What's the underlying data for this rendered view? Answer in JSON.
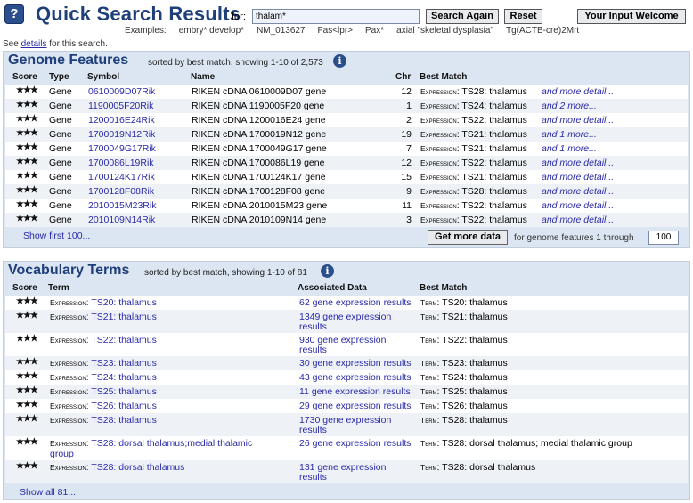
{
  "header": {
    "help_glyph": "?",
    "title": "Quick Search Results",
    "for_label": "for:",
    "query": "thalam*",
    "search_again": "Search Again",
    "reset": "Reset",
    "welcome": "Your Input Welcome",
    "examples_label": "Examples:",
    "examples": [
      "embry* develop*",
      "NM_013627",
      "Fas<lpr>",
      "Pax*",
      "axial \"skeletal dysplasia\"",
      "Tg(ACTB-cre)2Mrt"
    ],
    "see_pre": "See",
    "see_link": "details",
    "see_post": "for this search."
  },
  "genome": {
    "title": "Genome Features",
    "subtitle": "sorted by best match, showing 1-10 of 2,573",
    "columns": {
      "score": "Score",
      "type": "Type",
      "symbol": "Symbol",
      "name": "Name",
      "chr": "Chr",
      "best": "Best Match"
    },
    "rows": [
      {
        "stars": "★★★",
        "type": "Gene",
        "symbol": "0610009D07Rik",
        "name": "RIKEN cDNA 0610009D07 gene",
        "chr": "12",
        "exp": "Expression",
        "match": ": TS28: thalamus",
        "more": "and more detail..."
      },
      {
        "stars": "★★★",
        "type": "Gene",
        "symbol": "1190005F20Rik",
        "name": "RIKEN cDNA 1190005F20 gene",
        "chr": "1",
        "exp": "Expression",
        "match": ": TS24: thalamus",
        "more": "and 2 more..."
      },
      {
        "stars": "★★★",
        "type": "Gene",
        "symbol": "1200016E24Rik",
        "name": "RIKEN cDNA 1200016E24 gene",
        "chr": "2",
        "exp": "Expression",
        "match": ": TS22: thalamus",
        "more": "and more detail..."
      },
      {
        "stars": "★★★",
        "type": "Gene",
        "symbol": "1700019N12Rik",
        "name": "RIKEN cDNA 1700019N12 gene",
        "chr": "19",
        "exp": "Expression",
        "match": ": TS21: thalamus",
        "more": "and 1 more..."
      },
      {
        "stars": "★★★",
        "type": "Gene",
        "symbol": "1700049G17Rik",
        "name": "RIKEN cDNA 1700049G17 gene",
        "chr": "7",
        "exp": "Expression",
        "match": ": TS21: thalamus",
        "more": "and 1 more..."
      },
      {
        "stars": "★★★",
        "type": "Gene",
        "symbol": "1700086L19Rik",
        "name": "RIKEN cDNA 1700086L19 gene",
        "chr": "12",
        "exp": "Expression",
        "match": ": TS22: thalamus",
        "more": "and more detail..."
      },
      {
        "stars": "★★★",
        "type": "Gene",
        "symbol": "1700124K17Rik",
        "name": "RIKEN cDNA 1700124K17 gene",
        "chr": "15",
        "exp": "Expression",
        "match": ": TS21: thalamus",
        "more": "and more detail..."
      },
      {
        "stars": "★★★",
        "type": "Gene",
        "symbol": "1700128F08Rik",
        "name": "RIKEN cDNA 1700128F08 gene",
        "chr": "9",
        "exp": "Expression",
        "match": ": TS28: thalamus",
        "more": "and more detail..."
      },
      {
        "stars": "★★★",
        "type": "Gene",
        "symbol": "2010015M23Rik",
        "name": "RIKEN cDNA 2010015M23 gene",
        "chr": "11",
        "exp": "Expression",
        "match": ": TS22: thalamus",
        "more": "and more detail..."
      },
      {
        "stars": "★★★",
        "type": "Gene",
        "symbol": "2010109N14Rik",
        "name": "RIKEN cDNA 2010109N14 gene",
        "chr": "3",
        "exp": "Expression",
        "match": ": TS22: thalamus",
        "more": "and more detail..."
      }
    ],
    "show_first": "Show first 100...",
    "get_more": "Get more data",
    "get_more_suffix": "for genome features 1 through",
    "through_value": "100"
  },
  "vocab": {
    "title": "Vocabulary Terms",
    "subtitle": "sorted by best match, showing 1-10 of 81",
    "columns": {
      "score": "Score",
      "term": "Term",
      "assoc": "Associated Data",
      "best": "Best Match"
    },
    "rows": [
      {
        "stars": "★★★",
        "exp": "Expression",
        "term": ": TS20: thalamus",
        "term2": "",
        "assoc": "62 gene expression results",
        "assoc2": "",
        "bm_label": "Term",
        "bm": ": TS20: thalamus"
      },
      {
        "stars": "★★★",
        "exp": "Expression",
        "term": ": TS21: thalamus",
        "term2": "",
        "assoc": "1349 gene expression",
        "assoc2": "results",
        "bm_label": "Term",
        "bm": ": TS21: thalamus"
      },
      {
        "stars": "★★★",
        "exp": "Expression",
        "term": ": TS22: thalamus",
        "term2": "",
        "assoc": "930 gene expression",
        "assoc2": "results",
        "bm_label": "Term",
        "bm": ": TS22: thalamus"
      },
      {
        "stars": "★★★",
        "exp": "Expression",
        "term": ": TS23: thalamus",
        "term2": "",
        "assoc": "30 gene expression results",
        "assoc2": "",
        "bm_label": "Term",
        "bm": ": TS23: thalamus"
      },
      {
        "stars": "★★★",
        "exp": "Expression",
        "term": ": TS24: thalamus",
        "term2": "",
        "assoc": "43 gene expression results",
        "assoc2": "",
        "bm_label": "Term",
        "bm": ": TS24: thalamus"
      },
      {
        "stars": "★★★",
        "exp": "Expression",
        "term": ": TS25: thalamus",
        "term2": "",
        "assoc": "11 gene expression results",
        "assoc2": "",
        "bm_label": "Term",
        "bm": ": TS25: thalamus"
      },
      {
        "stars": "★★★",
        "exp": "Expression",
        "term": ": TS26: thalamus",
        "term2": "",
        "assoc": "29 gene expression results",
        "assoc2": "",
        "bm_label": "Term",
        "bm": ": TS26: thalamus"
      },
      {
        "stars": "★★★",
        "exp": "Expression",
        "term": ": TS28: thalamus",
        "term2": "",
        "assoc": "1730 gene expression",
        "assoc2": "results",
        "bm_label": "Term",
        "bm": ": TS28: thalamus"
      },
      {
        "stars": "★★★",
        "exp": "Expression",
        "term": ": TS28: dorsal thalamus;medial thalamic",
        "term2": "group",
        "assoc": "26 gene expression results",
        "assoc2": "",
        "bm_label": "Term",
        "bm": ": TS28: dorsal thalamus; medial thalamic group"
      },
      {
        "stars": "★★★",
        "exp": "Expression",
        "term": ": TS28: dorsal thalamus",
        "term2": "",
        "assoc": "131 gene expression",
        "assoc2": "results",
        "bm_label": "Term",
        "bm": ": TS28: dorsal thalamus"
      }
    ],
    "show_all": "Show all 81..."
  },
  "colors": {
    "header_blue": "#1f3f7a",
    "link": "#2a2aa8",
    "panel": "#dce6f2"
  }
}
